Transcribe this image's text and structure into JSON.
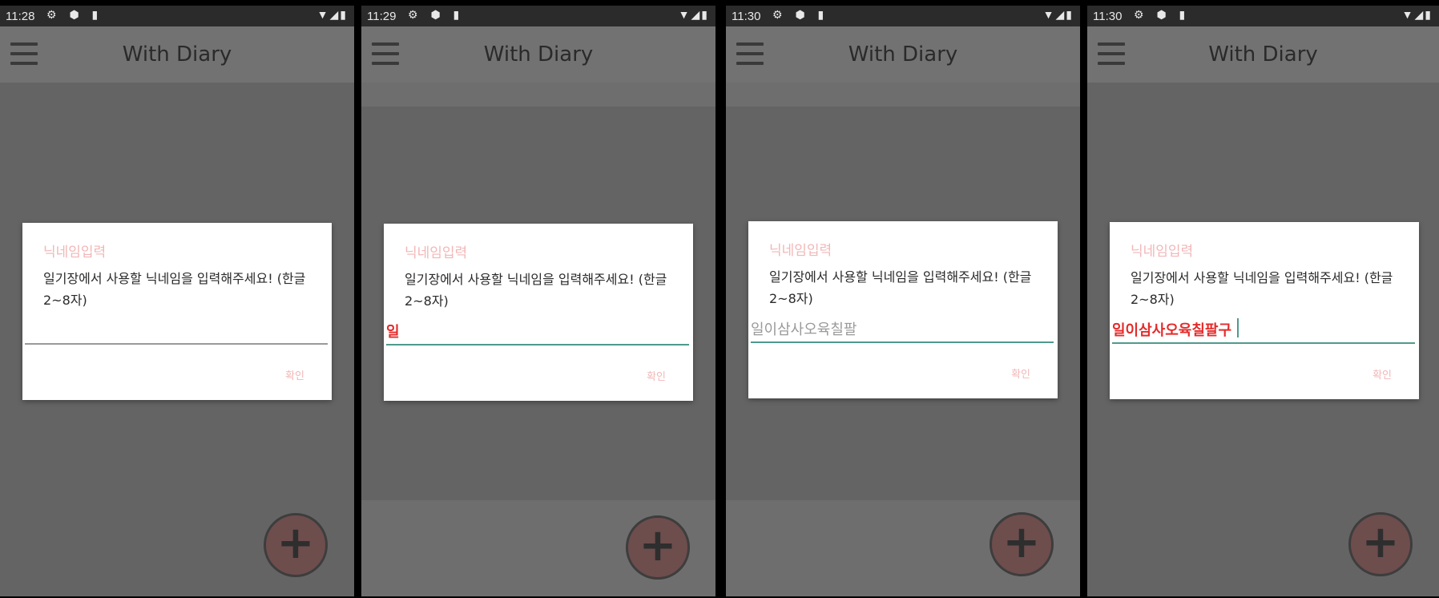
{
  "app_title": "With Diary",
  "dialog": {
    "title": "닉네임입력",
    "message": "일기장에서 사용할 닉네임을 입력해주세요! (한글 2~8자)",
    "ok_label": "확인"
  },
  "fab_symbol": "+",
  "colors": {
    "dialog_title": "#f2b7b7",
    "input_focus_line": "#4f9a8c",
    "input_error_text": "#e52b2b",
    "fab": "#6e4d4d"
  },
  "screens": [
    {
      "time": "11:28",
      "status_icons": "⚙ ⬢ ▮",
      "status_right": "▼◢▮",
      "input_value": "",
      "input_state": "empty"
    },
    {
      "time": "11:29",
      "status_icons": "⚙ ⬢ ▮",
      "status_right": "▼◢▮",
      "input_value": "일",
      "input_state": "invalid"
    },
    {
      "time": "11:30",
      "status_icons": "⚙ ⬢ ▮",
      "status_right": "▼◢▮",
      "input_value": "일이삼사오육칠팔",
      "input_state": "valid"
    },
    {
      "time": "11:30",
      "status_icons": "⚙ ⬢ ▮",
      "status_right": "▼◢▮",
      "input_value": "일이삼사오육칠팔구",
      "input_state": "invalid"
    }
  ]
}
